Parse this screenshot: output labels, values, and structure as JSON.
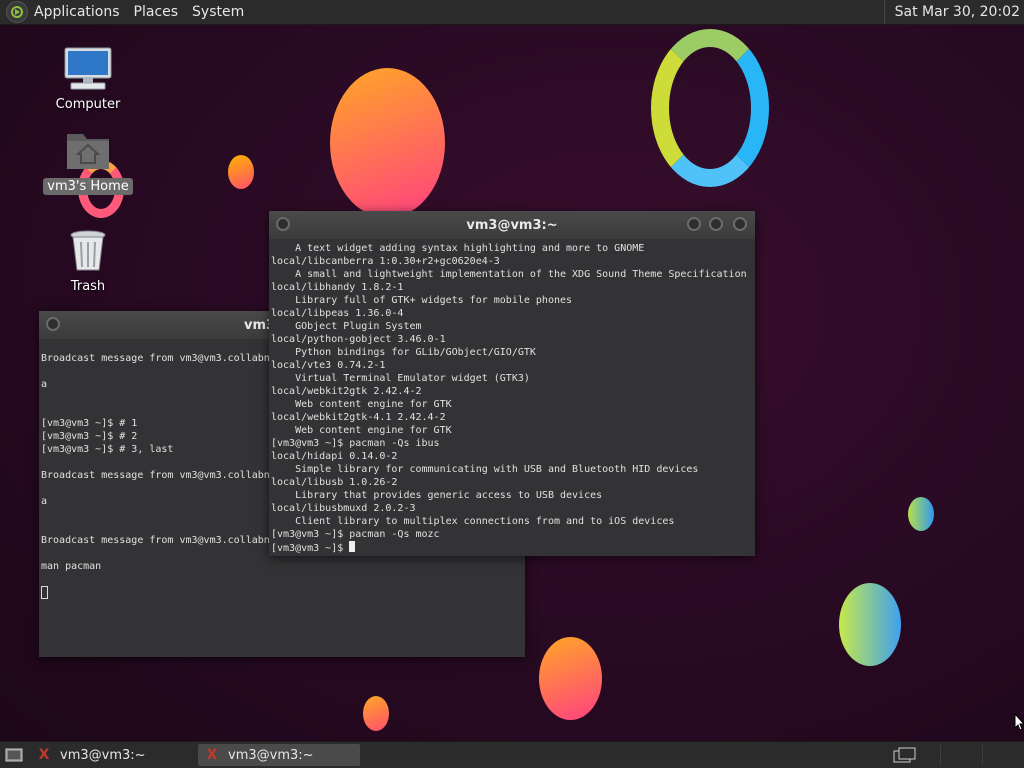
{
  "top_panel": {
    "menus": [
      "Applications",
      "Places",
      "System"
    ],
    "clock": "Sat Mar 30, 20:02"
  },
  "desktop_icons": [
    {
      "label": "Computer",
      "icon": "computer-icon"
    },
    {
      "label": "vm3's Home",
      "icon": "home-folder-icon"
    },
    {
      "label": "Trash",
      "icon": "trash-icon"
    }
  ],
  "front_terminal": {
    "title": "vm3@vm3:~",
    "lines": [
      "    A text widget adding syntax highlighting and more to GNOME",
      "local/libcanberra 1:0.30+r2+gc0620e4-3",
      "    A small and lightweight implementation of the XDG Sound Theme Specification",
      "local/libhandy 1.8.2-1",
      "    Library full of GTK+ widgets for mobile phones",
      "local/libpeas 1.36.0-4",
      "    GObject Plugin System",
      "local/python-gobject 3.46.0-1",
      "    Python bindings for GLib/GObject/GIO/GTK",
      "local/vte3 0.74.2-1",
      "    Virtual Terminal Emulator widget (GTK3)",
      "local/webkit2gtk 2.42.4-2",
      "    Web content engine for GTK",
      "local/webkit2gtk-4.1 2.42.4-2",
      "    Web content engine for GTK",
      "[vm3@vm3 ~]$ pacman -Qs ibus",
      "local/hidapi 0.14.0-2",
      "    Simple library for communicating with USB and Bluetooth HID devices",
      "local/libusb 1.0.26-2",
      "    Library that provides generic access to USB devices",
      "local/libusbmuxd 2.0.2-3",
      "    Client library to multiplex connections from and to iOS devices",
      "[vm3@vm3 ~]$ pacman -Qs mozc"
    ],
    "prompt": "[vm3@vm3 ~]$ "
  },
  "back_terminal": {
    "title": "vm3",
    "lines": [
      "",
      "Broadcast message from vm3@vm3.collabn",
      "",
      "a",
      "",
      "",
      "[vm3@vm3 ~]$ # 1",
      "[vm3@vm3 ~]$ # 2",
      "[vm3@vm3 ~]$ # 3, last",
      "",
      "Broadcast message from vm3@vm3.collabn",
      "",
      "a",
      "",
      "",
      "Broadcast message from vm3@vm3.collabn",
      "",
      "man pacman",
      ""
    ]
  },
  "taskbar": {
    "tasks": [
      {
        "label": "vm3@vm3:~",
        "active": false
      },
      {
        "label": "vm3@vm3:~",
        "active": true
      }
    ]
  }
}
